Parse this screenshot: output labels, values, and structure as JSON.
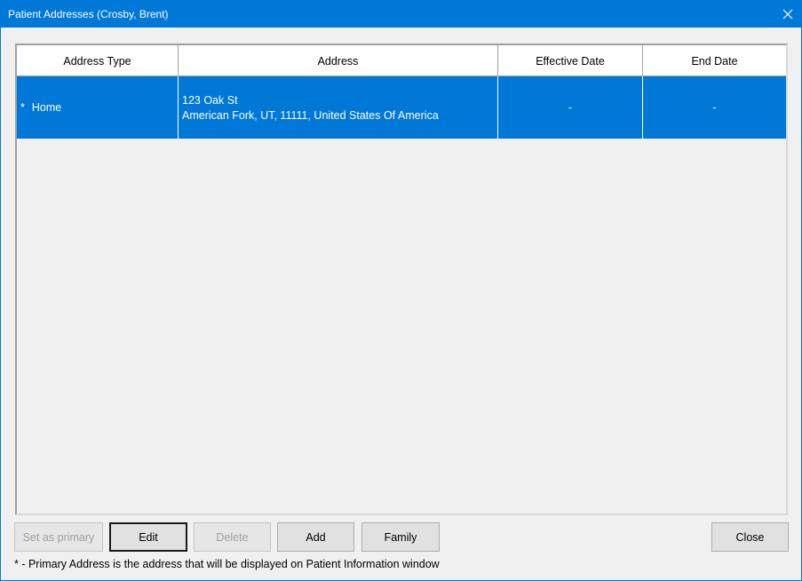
{
  "window": {
    "title": "Patient Addresses (Crosby, Brent)",
    "accent_color": "#0078d7",
    "close_icon": "close-icon"
  },
  "grid": {
    "columns": [
      "Address Type",
      "Address",
      "Effective Date",
      "End Date"
    ],
    "rows": [
      {
        "primary_marker": "*",
        "address_type": "Home",
        "address_line1": "123 Oak St",
        "address_line2": "American Fork, UT, 11111, United States Of America",
        "effective_date": "-",
        "end_date": "-",
        "selected": true
      }
    ]
  },
  "buttons": {
    "set_primary": "Set as primary",
    "edit": "Edit",
    "delete": "Delete",
    "add": "Add",
    "family": "Family",
    "close": "Close"
  },
  "footnote": "* - Primary Address is the address that will be displayed on Patient Information window"
}
